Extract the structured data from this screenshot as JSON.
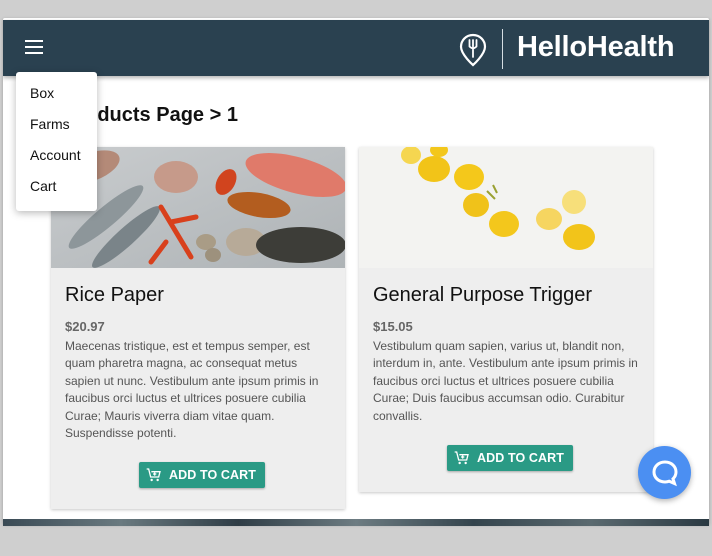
{
  "app": {
    "brand": "HelloHealth",
    "brand_color": "#2a4150",
    "accent_color": "#2a9a85"
  },
  "nav_menu": {
    "items": [
      {
        "label": "Box"
      },
      {
        "label": "Farms"
      },
      {
        "label": "Account"
      },
      {
        "label": "Cart"
      }
    ]
  },
  "page": {
    "title": "Products Page > 1"
  },
  "products": [
    {
      "name": "Rice Paper",
      "price": "$20.97",
      "description": "Maecenas tristique, est et tempus semper, est quam pharetra magna, ac consequat metus sapien ut nunc. Vestibulum ante ipsum primis in faucibus orci luctus et ultrices posuere cubilia Curae; Mauris viverra diam vitae quam. Suspendisse potenti.",
      "button_label": "ADD TO CART",
      "image": "seafood-on-ice-photo"
    },
    {
      "name": "General Purpose Trigger",
      "price": "$15.05",
      "description": "Vestibulum quam sapien, varius ut, blandit non, interdum in, ante. Vestibulum ante ipsum primis in faucibus orci luctus et ultrices posuere cubilia Curae; Duis faucibus accumsan odio. Curabitur convallis.",
      "button_label": "ADD TO CART",
      "image": "lemons-on-white-photo"
    }
  ],
  "icons": {
    "menu": "hamburger-icon",
    "logo": "location-pin-fork-icon",
    "cart": "add-shopping-cart-icon",
    "chat": "chat-bubble-icon"
  }
}
